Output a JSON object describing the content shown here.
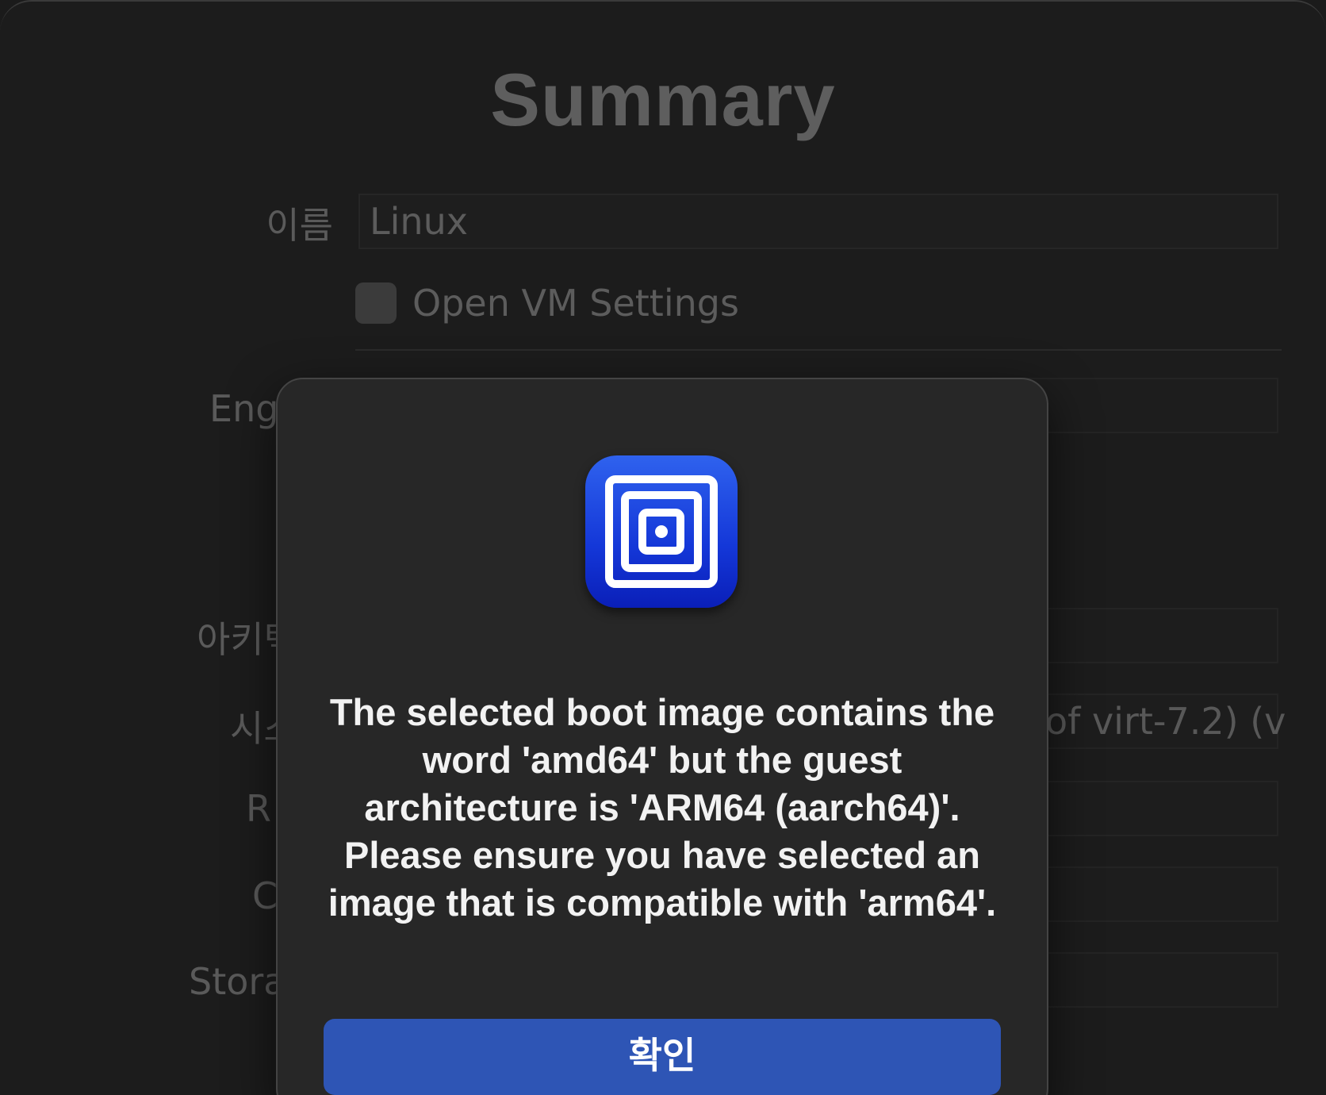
{
  "window": {
    "title": "Summary"
  },
  "form": {
    "name_label": "이름",
    "name_value": "Linux",
    "open_settings_label": "Open VM Settings",
    "open_settings_checked": false,
    "engine_label_partial": "Eng",
    "architecture_label_partial": "아키텍",
    "system_label_partial": "시스",
    "ram_label_partial": "R",
    "cpu_label_partial": "C",
    "storage_label_partial": "Stora",
    "system_value_partial": "of virt-7.2) (v"
  },
  "alert": {
    "icon": "utm-app-icon",
    "message": "The selected boot image contains the word 'amd64' but the guest architecture is 'ARM64 (aarch64)'. Please ensure you have selected an image that is compatible with 'arm64'.",
    "confirm_label": "확인",
    "confirm_color": "#2e55b5"
  }
}
